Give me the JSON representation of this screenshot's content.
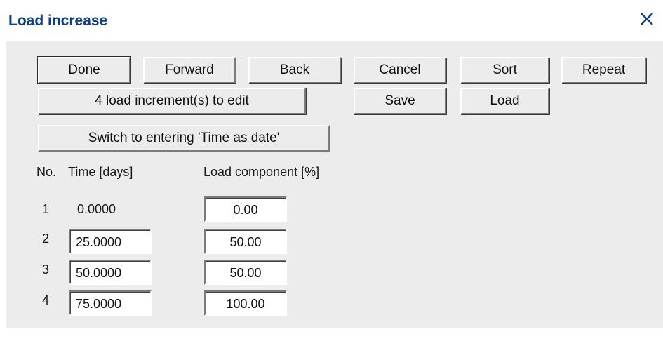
{
  "window": {
    "title": "Load increase",
    "accent_color": "#0d3c8c",
    "client_color": "#ececec"
  },
  "buttons": {
    "done": "Done",
    "forward": "Forward",
    "back": "Back",
    "cancel": "Cancel",
    "sort": "Sort",
    "repeat": "Repeat",
    "edit_increments": "4 load increment(s) to edit",
    "save": "Save",
    "load": "Load",
    "switch_time_mode": "Switch to entering 'Time as date'"
  },
  "table": {
    "headers": {
      "no": "No.",
      "time": "Time [days]",
      "load": "Load component [%]"
    },
    "rows": [
      {
        "no": "1",
        "time": "0.0000",
        "load": "0.00"
      },
      {
        "no": "2",
        "time": "25.0000",
        "load": "50.00"
      },
      {
        "no": "3",
        "time": "50.0000",
        "load": "50.00"
      },
      {
        "no": "4",
        "time": "75.0000",
        "load": "100.00"
      }
    ]
  },
  "icons": {
    "close": "close-icon"
  }
}
